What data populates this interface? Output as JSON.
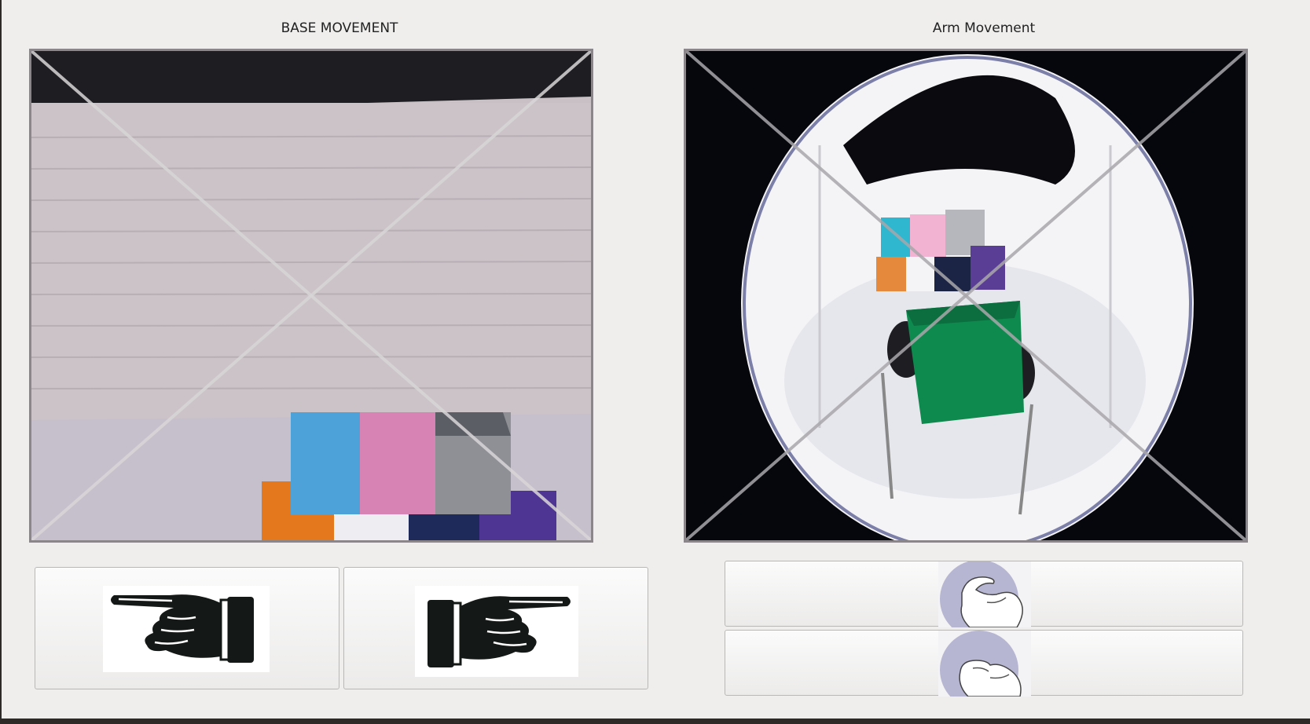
{
  "window": {
    "base_title": "BASE MOVEMENT",
    "arm_title": "Arm Movement"
  },
  "feeds": {
    "base_camera": {
      "icon": "front-camera-feed"
    },
    "arm_camera": {
      "icon": "fisheye-camera-feed"
    }
  },
  "buttons": {
    "move_left": {
      "icon": "hand-pointing-left-icon"
    },
    "move_right": {
      "icon": "hand-pointing-right-icon"
    },
    "gripper_open": {
      "icon": "hand-open-grip-icon"
    },
    "gripper_close": {
      "icon": "hand-pinch-grip-icon"
    }
  },
  "colors": {
    "background": "#efeeed",
    "block_blue": "#4da2d9",
    "block_pink": "#d784b5",
    "block_gray": "#8e9095",
    "block_orange": "#e3781c",
    "block_green": "#0f8a4e",
    "block_navy": "#1d2a5a",
    "block_purple": "#4e3594",
    "gesture_circle": "#b7b6d2"
  }
}
